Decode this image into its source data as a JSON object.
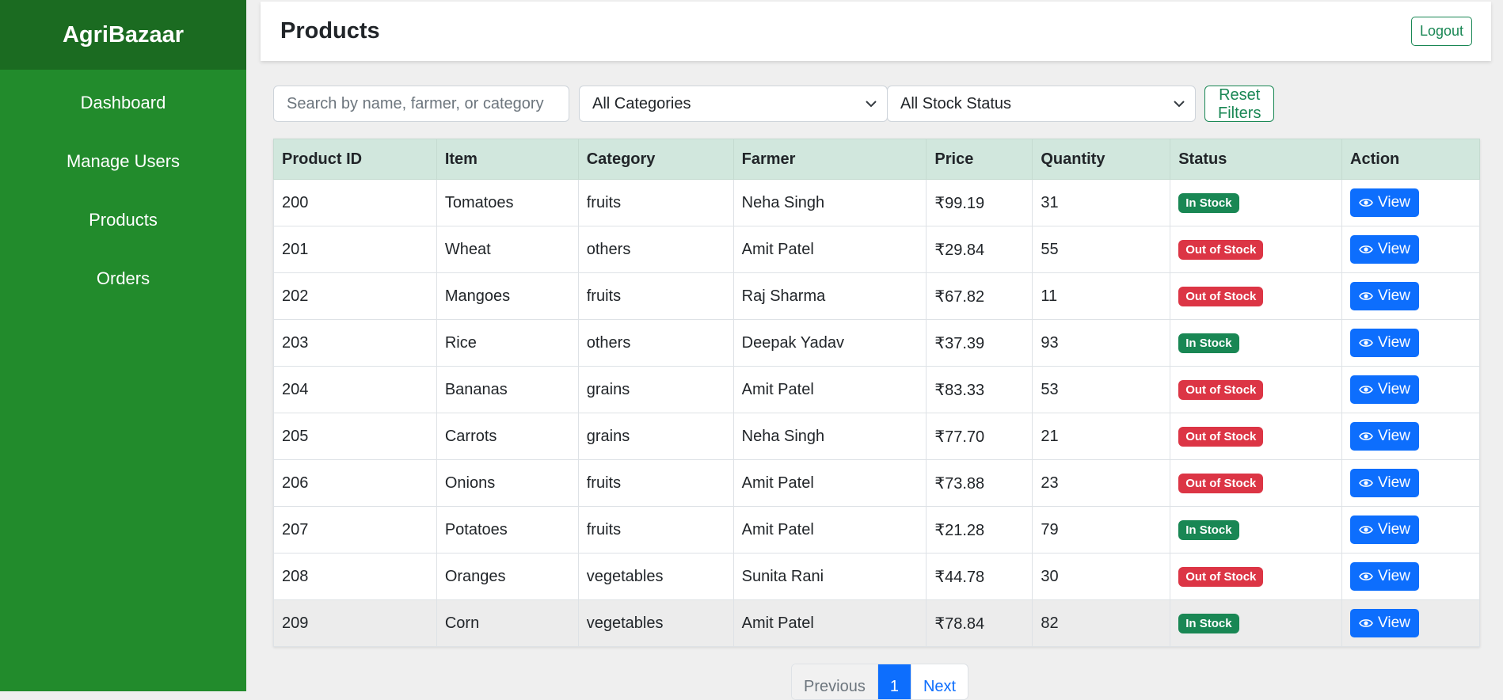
{
  "sidebar": {
    "brand": "AgriBazaar",
    "items": [
      {
        "label": "Dashboard"
      },
      {
        "label": "Manage Users"
      },
      {
        "label": "Products"
      },
      {
        "label": "Orders"
      }
    ]
  },
  "header": {
    "title": "Products",
    "logout_label": "Logout"
  },
  "filters": {
    "search_placeholder": "Search by name, farmer, or category",
    "search_value": "",
    "category_selected": "All Categories",
    "stock_selected": "All Stock Status",
    "reset_label": "Reset Filters"
  },
  "table": {
    "columns": [
      "Product ID",
      "Item",
      "Category",
      "Farmer",
      "Price",
      "Quantity",
      "Status",
      "Action"
    ],
    "view_label": "View",
    "rows": [
      {
        "id": "200",
        "item": "Tomatoes",
        "category": "fruits",
        "farmer": "Neha Singh",
        "price": "₹99.19",
        "quantity": "31",
        "status": "In Stock",
        "in_stock": true
      },
      {
        "id": "201",
        "item": "Wheat",
        "category": "others",
        "farmer": "Amit Patel",
        "price": "₹29.84",
        "quantity": "55",
        "status": "Out of Stock",
        "in_stock": false
      },
      {
        "id": "202",
        "item": "Mangoes",
        "category": "fruits",
        "farmer": "Raj Sharma",
        "price": "₹67.82",
        "quantity": "11",
        "status": "Out of Stock",
        "in_stock": false
      },
      {
        "id": "203",
        "item": "Rice",
        "category": "others",
        "farmer": "Deepak Yadav",
        "price": "₹37.39",
        "quantity": "93",
        "status": "In Stock",
        "in_stock": true
      },
      {
        "id": "204",
        "item": "Bananas",
        "category": "grains",
        "farmer": "Amit Patel",
        "price": "₹83.33",
        "quantity": "53",
        "status": "Out of Stock",
        "in_stock": false
      },
      {
        "id": "205",
        "item": "Carrots",
        "category": "grains",
        "farmer": "Neha Singh",
        "price": "₹77.70",
        "quantity": "21",
        "status": "Out of Stock",
        "in_stock": false
      },
      {
        "id": "206",
        "item": "Onions",
        "category": "fruits",
        "farmer": "Amit Patel",
        "price": "₹73.88",
        "quantity": "23",
        "status": "Out of Stock",
        "in_stock": false
      },
      {
        "id": "207",
        "item": "Potatoes",
        "category": "fruits",
        "farmer": "Amit Patel",
        "price": "₹21.28",
        "quantity": "79",
        "status": "In Stock",
        "in_stock": true
      },
      {
        "id": "208",
        "item": "Oranges",
        "category": "vegetables",
        "farmer": "Sunita Rani",
        "price": "₹44.78",
        "quantity": "30",
        "status": "Out of Stock",
        "in_stock": false
      },
      {
        "id": "209",
        "item": "Corn",
        "category": "vegetables",
        "farmer": "Amit Patel",
        "price": "₹78.84",
        "quantity": "82",
        "status": "In Stock",
        "in_stock": true
      }
    ]
  },
  "pagination": {
    "previous_label": "Previous",
    "current_page": "1",
    "next_label": "Next"
  },
  "colors": {
    "sidebar": "#228b2c",
    "brand_bar": "#1b6b21",
    "table_header": "#d1e7dd",
    "in_stock": "#198754",
    "out_of_stock": "#dc3545",
    "primary": "#0d6efd"
  },
  "icons": {
    "view": "eye-icon",
    "dropdown": "chevron-down-icon"
  }
}
